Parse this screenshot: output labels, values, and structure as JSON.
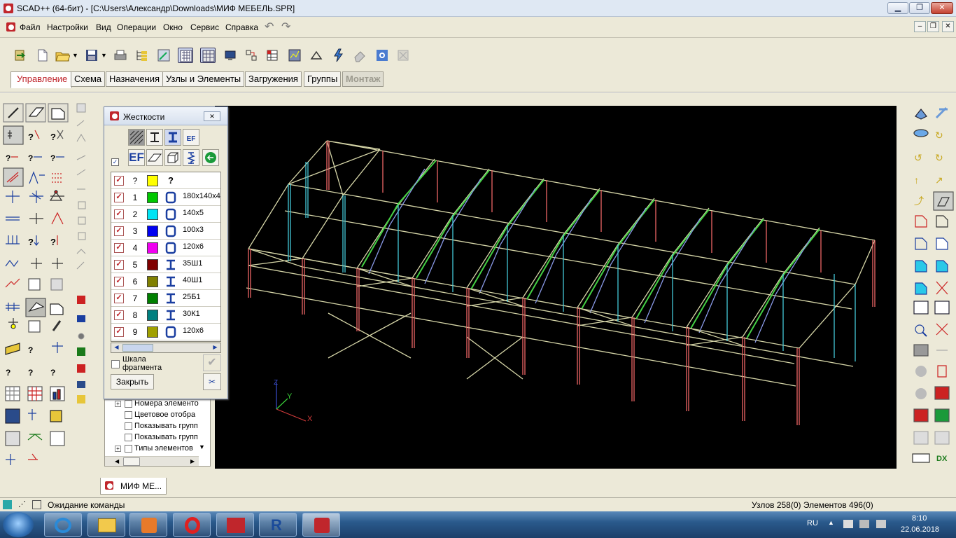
{
  "window": {
    "title": "SCAD++ (64-бит) - [C:\\Users\\Александр\\Downloads\\МИФ МЕБЕЛЬ.SPR]",
    "minimize": "▁",
    "maximize": "❐",
    "close": "✕"
  },
  "menu": {
    "items": [
      "Файл",
      "Настройки",
      "Вид",
      "Операции",
      "Окно",
      "Сервис",
      "Справка"
    ],
    "undo": "↶",
    "redo": "↷",
    "mdi_min": "–",
    "mdi_restore": "❐",
    "mdi_close": "✕"
  },
  "tabs": [
    {
      "label": "Управление",
      "active": true
    },
    {
      "label": "Схема"
    },
    {
      "label": "Назначения"
    },
    {
      "label": "Узлы и Элементы"
    },
    {
      "label": "Загружения"
    },
    {
      "label": "Группы"
    },
    {
      "label": "Монтаж",
      "disabled": true
    }
  ],
  "dialog": {
    "title": "Жесткости",
    "close": "✕",
    "type_header": "?",
    "shape_header": "?",
    "rows": [
      {
        "num": "1",
        "color": "#00c800",
        "shape": "box",
        "section": "180x140x4"
      },
      {
        "num": "2",
        "color": "#00e4f4",
        "shape": "box",
        "section": "140x5"
      },
      {
        "num": "3",
        "color": "#0000f0",
        "shape": "box",
        "section": "100x3"
      },
      {
        "num": "4",
        "color": "#f000f0",
        "shape": "box",
        "section": "120x6"
      },
      {
        "num": "5",
        "color": "#800000",
        "shape": "ibeam",
        "section": "35Ш1"
      },
      {
        "num": "6",
        "color": "#808000",
        "shape": "ibeam",
        "section": "40Ш1"
      },
      {
        "num": "7",
        "color": "#008000",
        "shape": "ibeam",
        "section": "25Б1"
      },
      {
        "num": "8",
        "color": "#008080",
        "shape": "ibeam",
        "section": "30К1"
      },
      {
        "num": "9",
        "color": "#a0a000",
        "shape": "box",
        "section": "120x6"
      }
    ],
    "header_color": "#ffff00",
    "scale_label": "Шкала фрагмента",
    "close_button": "Закрыть",
    "ef_label": "EF",
    "ef_small": "EF"
  },
  "tree": {
    "items": [
      {
        "label": "Номера элементо",
        "expand": true
      },
      {
        "label": "Цветовое отобра",
        "expand": false
      },
      {
        "label": "Показывать групп",
        "expand": false
      },
      {
        "label": "Показывать групп",
        "expand": false
      },
      {
        "label": "Типы элементов",
        "expand": true
      }
    ]
  },
  "axes": {
    "x": "X",
    "y": "Y",
    "z": "Z"
  },
  "doc_tab": "МИФ МЕ...",
  "status": {
    "text": "Ожидание команды",
    "counts": "Узлов 258(0) Элементов 496(0)"
  },
  "tray": {
    "lang": "RU",
    "time": "8:10",
    "date": "22.06.2018"
  },
  "right_dx": "DX"
}
